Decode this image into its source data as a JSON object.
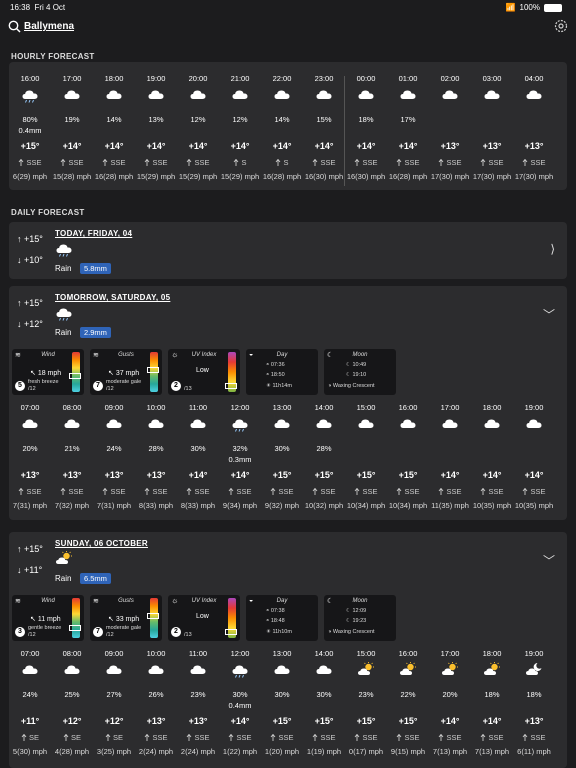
{
  "status": {
    "time": "16:38",
    "date": "Fri 4 Oct",
    "battery": "100%"
  },
  "header": {
    "location": "Ballymena"
  },
  "hourly": {
    "title": "HOURLY FORECAST",
    "columns": [
      {
        "t": "16:00",
        "icon": "rain-cloud",
        "pct": "80%",
        "mm": "0.4mm",
        "temp": "+15°",
        "dir": "SSE",
        "wind": "6(29) mph"
      },
      {
        "t": "17:00",
        "icon": "cloud",
        "pct": "19%",
        "mm": "",
        "temp": "+14°",
        "dir": "SSE",
        "wind": "15(28) mph"
      },
      {
        "t": "18:00",
        "icon": "cloud",
        "pct": "14%",
        "mm": "",
        "temp": "+14°",
        "dir": "SSE",
        "wind": "16(28) mph"
      },
      {
        "t": "19:00",
        "icon": "cloud",
        "pct": "13%",
        "mm": "",
        "temp": "+14°",
        "dir": "SSE",
        "wind": "15(29) mph"
      },
      {
        "t": "20:00",
        "icon": "cloud",
        "pct": "12%",
        "mm": "",
        "temp": "+14°",
        "dir": "SSE",
        "wind": "15(29) mph"
      },
      {
        "t": "21:00",
        "icon": "cloud",
        "pct": "12%",
        "mm": "",
        "temp": "+14°",
        "dir": "S",
        "wind": "15(29) mph"
      },
      {
        "t": "22:00",
        "icon": "cloud",
        "pct": "14%",
        "mm": "",
        "temp": "+14°",
        "dir": "S",
        "wind": "16(28) mph"
      },
      {
        "t": "23:00",
        "icon": "cloud",
        "pct": "15%",
        "mm": "",
        "temp": "+14°",
        "dir": "SSE",
        "wind": "16(30) mph"
      },
      {
        "t": "00:00",
        "icon": "cloud",
        "pct": "18%",
        "mm": "",
        "temp": "+14°",
        "dir": "SSE",
        "wind": "16(30) mph"
      },
      {
        "t": "01:00",
        "icon": "cloud",
        "pct": "17%",
        "mm": "",
        "temp": "+14°",
        "dir": "SSE",
        "wind": "16(28) mph"
      },
      {
        "t": "02:00",
        "icon": "cloud",
        "pct": "",
        "mm": "",
        "temp": "+13°",
        "dir": "SSE",
        "wind": "17(30) mph"
      },
      {
        "t": "03:00",
        "icon": "cloud",
        "pct": "",
        "mm": "",
        "temp": "+13°",
        "dir": "SSE",
        "wind": "17(30) mph"
      },
      {
        "t": "04:00",
        "icon": "cloud",
        "pct": "",
        "mm": "",
        "temp": "+13°",
        "dir": "SSE",
        "wind": "17(30) mph"
      },
      {
        "t": "",
        "icon": "cloud",
        "pct": "",
        "mm": "",
        "temp": "+",
        "dir": "",
        "wind": "17(2"
      }
    ]
  },
  "daily": {
    "title": "DAILY FORECAST",
    "days": [
      {
        "title": "TODAY, FRIDAY, 04",
        "high": "+15°",
        "low": "+10°",
        "rain_label": "Rain",
        "rain_mm": "5.8mm",
        "chevron": "⟩"
      },
      {
        "title": "TOMORROW, SATURDAY, 05",
        "high": "+15°",
        "low": "+12°",
        "rain_label": "Rain",
        "rain_mm": "2.9mm",
        "chevron": "﹀",
        "tiles": {
          "wind": {
            "title": "Wind",
            "speed": "18 mph",
            "level": "5",
            "desc": "fresh breeze",
            "scale": "/12",
            "fill": 0.42
          },
          "gusts": {
            "title": "Gusts",
            "speed": "37 mph",
            "level": "7",
            "desc": "moderate gale",
            "scale": "/12",
            "fill": 0.58
          },
          "uv": {
            "title": "UV Index",
            "value": "Low",
            "level": "2",
            "scale": "/13",
            "fill": 0.15
          },
          "day": {
            "title": "Day",
            "sunrise": "07:36",
            "sunset": "18:50",
            "length": "11h14m"
          },
          "moon": {
            "title": "Moon",
            "rise": "10:49",
            "set": "19:10",
            "phase": "Waxing Crescent"
          }
        },
        "columns": [
          {
            "t": "07:00",
            "icon": "cloud",
            "pct": "20%",
            "mm": "",
            "temp": "+13°",
            "dir": "SSE",
            "wind": "7(31) mph"
          },
          {
            "t": "08:00",
            "icon": "cloud",
            "pct": "21%",
            "mm": "",
            "temp": "+13°",
            "dir": "SSE",
            "wind": "7(32) mph"
          },
          {
            "t": "09:00",
            "icon": "cloud",
            "pct": "24%",
            "mm": "",
            "temp": "+13°",
            "dir": "SSE",
            "wind": "7(31) mph"
          },
          {
            "t": "10:00",
            "icon": "cloud",
            "pct": "28%",
            "mm": "",
            "temp": "+13°",
            "dir": "SSE",
            "wind": "8(33) mph"
          },
          {
            "t": "11:00",
            "icon": "cloud",
            "pct": "30%",
            "mm": "",
            "temp": "+14°",
            "dir": "SSE",
            "wind": "8(33) mph"
          },
          {
            "t": "12:00",
            "icon": "rain-cloud",
            "pct": "32%",
            "mm": "0.3mm",
            "temp": "+14°",
            "dir": "SSE",
            "wind": "9(34) mph"
          },
          {
            "t": "13:00",
            "icon": "cloud",
            "pct": "30%",
            "mm": "",
            "temp": "+15°",
            "dir": "SSE",
            "wind": "9(32) mph"
          },
          {
            "t": "14:00",
            "icon": "cloud",
            "pct": "28%",
            "mm": "",
            "temp": "+15°",
            "dir": "SSE",
            "wind": "10(32) mph"
          },
          {
            "t": "15:00",
            "icon": "cloud",
            "pct": "",
            "mm": "",
            "temp": "+15°",
            "dir": "SSE",
            "wind": "10(34) mph"
          },
          {
            "t": "16:00",
            "icon": "cloud",
            "pct": "",
            "mm": "",
            "temp": "+15°",
            "dir": "SSE",
            "wind": "10(34) mph"
          },
          {
            "t": "17:00",
            "icon": "cloud",
            "pct": "",
            "mm": "",
            "temp": "+14°",
            "dir": "SSE",
            "wind": "11(35) mph"
          },
          {
            "t": "18:00",
            "icon": "cloud",
            "pct": "",
            "mm": "",
            "temp": "+14°",
            "dir": "SSE",
            "wind": "10(35) mph"
          },
          {
            "t": "19:00",
            "icon": "cloud",
            "pct": "",
            "mm": "",
            "temp": "+14°",
            "dir": "SSE",
            "wind": "10(35) mph"
          },
          {
            "t": "20",
            "icon": "cloud",
            "pct": "",
            "mm": "",
            "temp": "+",
            "dir": "",
            "wind": "10"
          }
        ]
      },
      {
        "title": "SUNDAY, 06 OCTOBER",
        "high": "+15°",
        "low": "+11°",
        "rain_label": "Rain",
        "rain_mm": "6.5mm",
        "chevron": "﹀",
        "tiles": {
          "wind": {
            "title": "Wind",
            "speed": "11 mph",
            "level": "3",
            "desc": "gentle breeze",
            "scale": "/12",
            "fill": 0.25
          },
          "gusts": {
            "title": "Gusts",
            "speed": "33 mph",
            "level": "7",
            "desc": "moderate gale",
            "scale": "/12",
            "fill": 0.58
          },
          "uv": {
            "title": "UV Index",
            "value": "Low",
            "level": "2",
            "scale": "/13",
            "fill": 0.15
          },
          "day": {
            "title": "Day",
            "sunrise": "07:38",
            "sunset": "18:48",
            "length": "11h10m"
          },
          "moon": {
            "title": "Moon",
            "rise": "12:09",
            "set": "19:23",
            "phase": "Waxing Crescent"
          }
        },
        "columns": [
          {
            "t": "07:00",
            "icon": "cloud",
            "pct": "24%",
            "mm": "",
            "temp": "+11°",
            "dir": "SE",
            "wind": "5(30) mph"
          },
          {
            "t": "08:00",
            "icon": "cloud",
            "pct": "25%",
            "mm": "",
            "temp": "+12°",
            "dir": "SE",
            "wind": "4(28) mph"
          },
          {
            "t": "09:00",
            "icon": "cloud",
            "pct": "27%",
            "mm": "",
            "temp": "+12°",
            "dir": "SE",
            "wind": "3(25) mph"
          },
          {
            "t": "10:00",
            "icon": "cloud",
            "pct": "26%",
            "mm": "",
            "temp": "+13°",
            "dir": "SSE",
            "wind": "2(24) mph"
          },
          {
            "t": "11:00",
            "icon": "cloud",
            "pct": "23%",
            "mm": "",
            "temp": "+13°",
            "dir": "SSE",
            "wind": "2(24) mph"
          },
          {
            "t": "12:00",
            "icon": "rain-cloud",
            "pct": "30%",
            "mm": "0.4mm",
            "temp": "+14°",
            "dir": "SSE",
            "wind": "1(22) mph"
          },
          {
            "t": "13:00",
            "icon": "cloud",
            "pct": "30%",
            "mm": "",
            "temp": "+15°",
            "dir": "SSE",
            "wind": "1(20) mph"
          },
          {
            "t": "14:00",
            "icon": "cloud",
            "pct": "30%",
            "mm": "",
            "temp": "+15°",
            "dir": "SSE",
            "wind": "1(19) mph"
          },
          {
            "t": "15:00",
            "icon": "sun-cloud",
            "pct": "23%",
            "mm": "",
            "temp": "+15°",
            "dir": "SSE",
            "wind": "0(17) mph"
          },
          {
            "t": "16:00",
            "icon": "sun-cloud",
            "pct": "22%",
            "mm": "",
            "temp": "+15°",
            "dir": "SSE",
            "wind": "9(15) mph"
          },
          {
            "t": "17:00",
            "icon": "sun-cloud",
            "pct": "20%",
            "mm": "",
            "temp": "+14°",
            "dir": "SSE",
            "wind": "7(13) mph"
          },
          {
            "t": "18:00",
            "icon": "sun-cloud",
            "pct": "18%",
            "mm": "",
            "temp": "+14°",
            "dir": "SSE",
            "wind": "7(13) mph"
          },
          {
            "t": "19:00",
            "icon": "moon-cloud",
            "pct": "18%",
            "mm": "",
            "temp": "+13°",
            "dir": "SSE",
            "wind": "6(11) mph"
          },
          {
            "t": "",
            "icon": "cloud",
            "pct": "",
            "mm": "",
            "temp": "+",
            "dir": "",
            "wind": "6("
          }
        ]
      }
    ]
  }
}
